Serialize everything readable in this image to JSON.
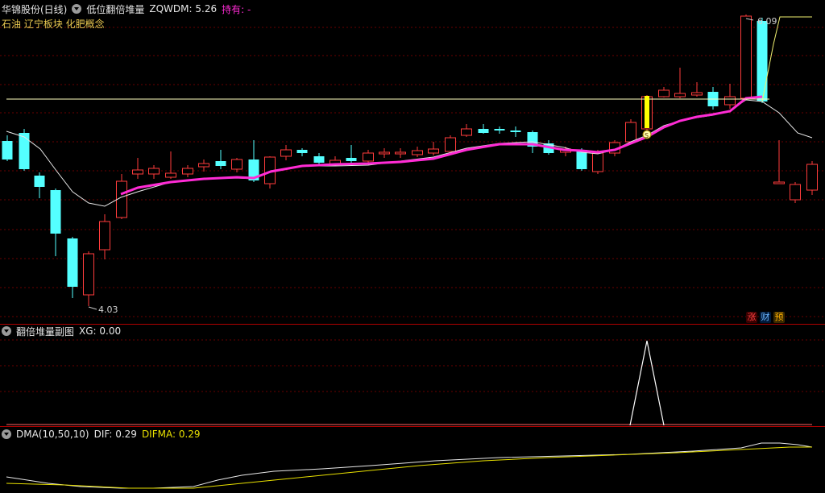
{
  "header": {
    "stock": "华锦股份(日线)",
    "indicator": "低位翻倍堆量",
    "zqwdm_label": "ZQWDM: 5.26",
    "hold_label": "持有: -"
  },
  "sectors": "石油 辽宁板块 化肥概念",
  "annotations": {
    "high_label": "6.09",
    "low_label": "4.03",
    "signal_marker": "S"
  },
  "badges": {
    "zhang": "涨",
    "cai": "财",
    "yu": "预"
  },
  "sub1": {
    "title": "翻倍堆量副图",
    "value_label": "XG: 0.00"
  },
  "sub2": {
    "title": "DMA(10,50,10)",
    "dif_label": "DIF: 0.29",
    "difma_label": "DIFMA: 0.29"
  },
  "colors": {
    "background": "#000000",
    "up_candle": "#ff3c3c",
    "down_candle": "#54ffff",
    "ma_line": "#ff2bd5",
    "grid": "#7a0000",
    "signal": "#ffff00"
  },
  "chart_data": {
    "type": "candlestick",
    "price_high": 6.09,
    "price_low": 4.03,
    "zqwdm": 5.26,
    "xg": 0.0,
    "dif": 0.29,
    "difma": 0.29
  }
}
